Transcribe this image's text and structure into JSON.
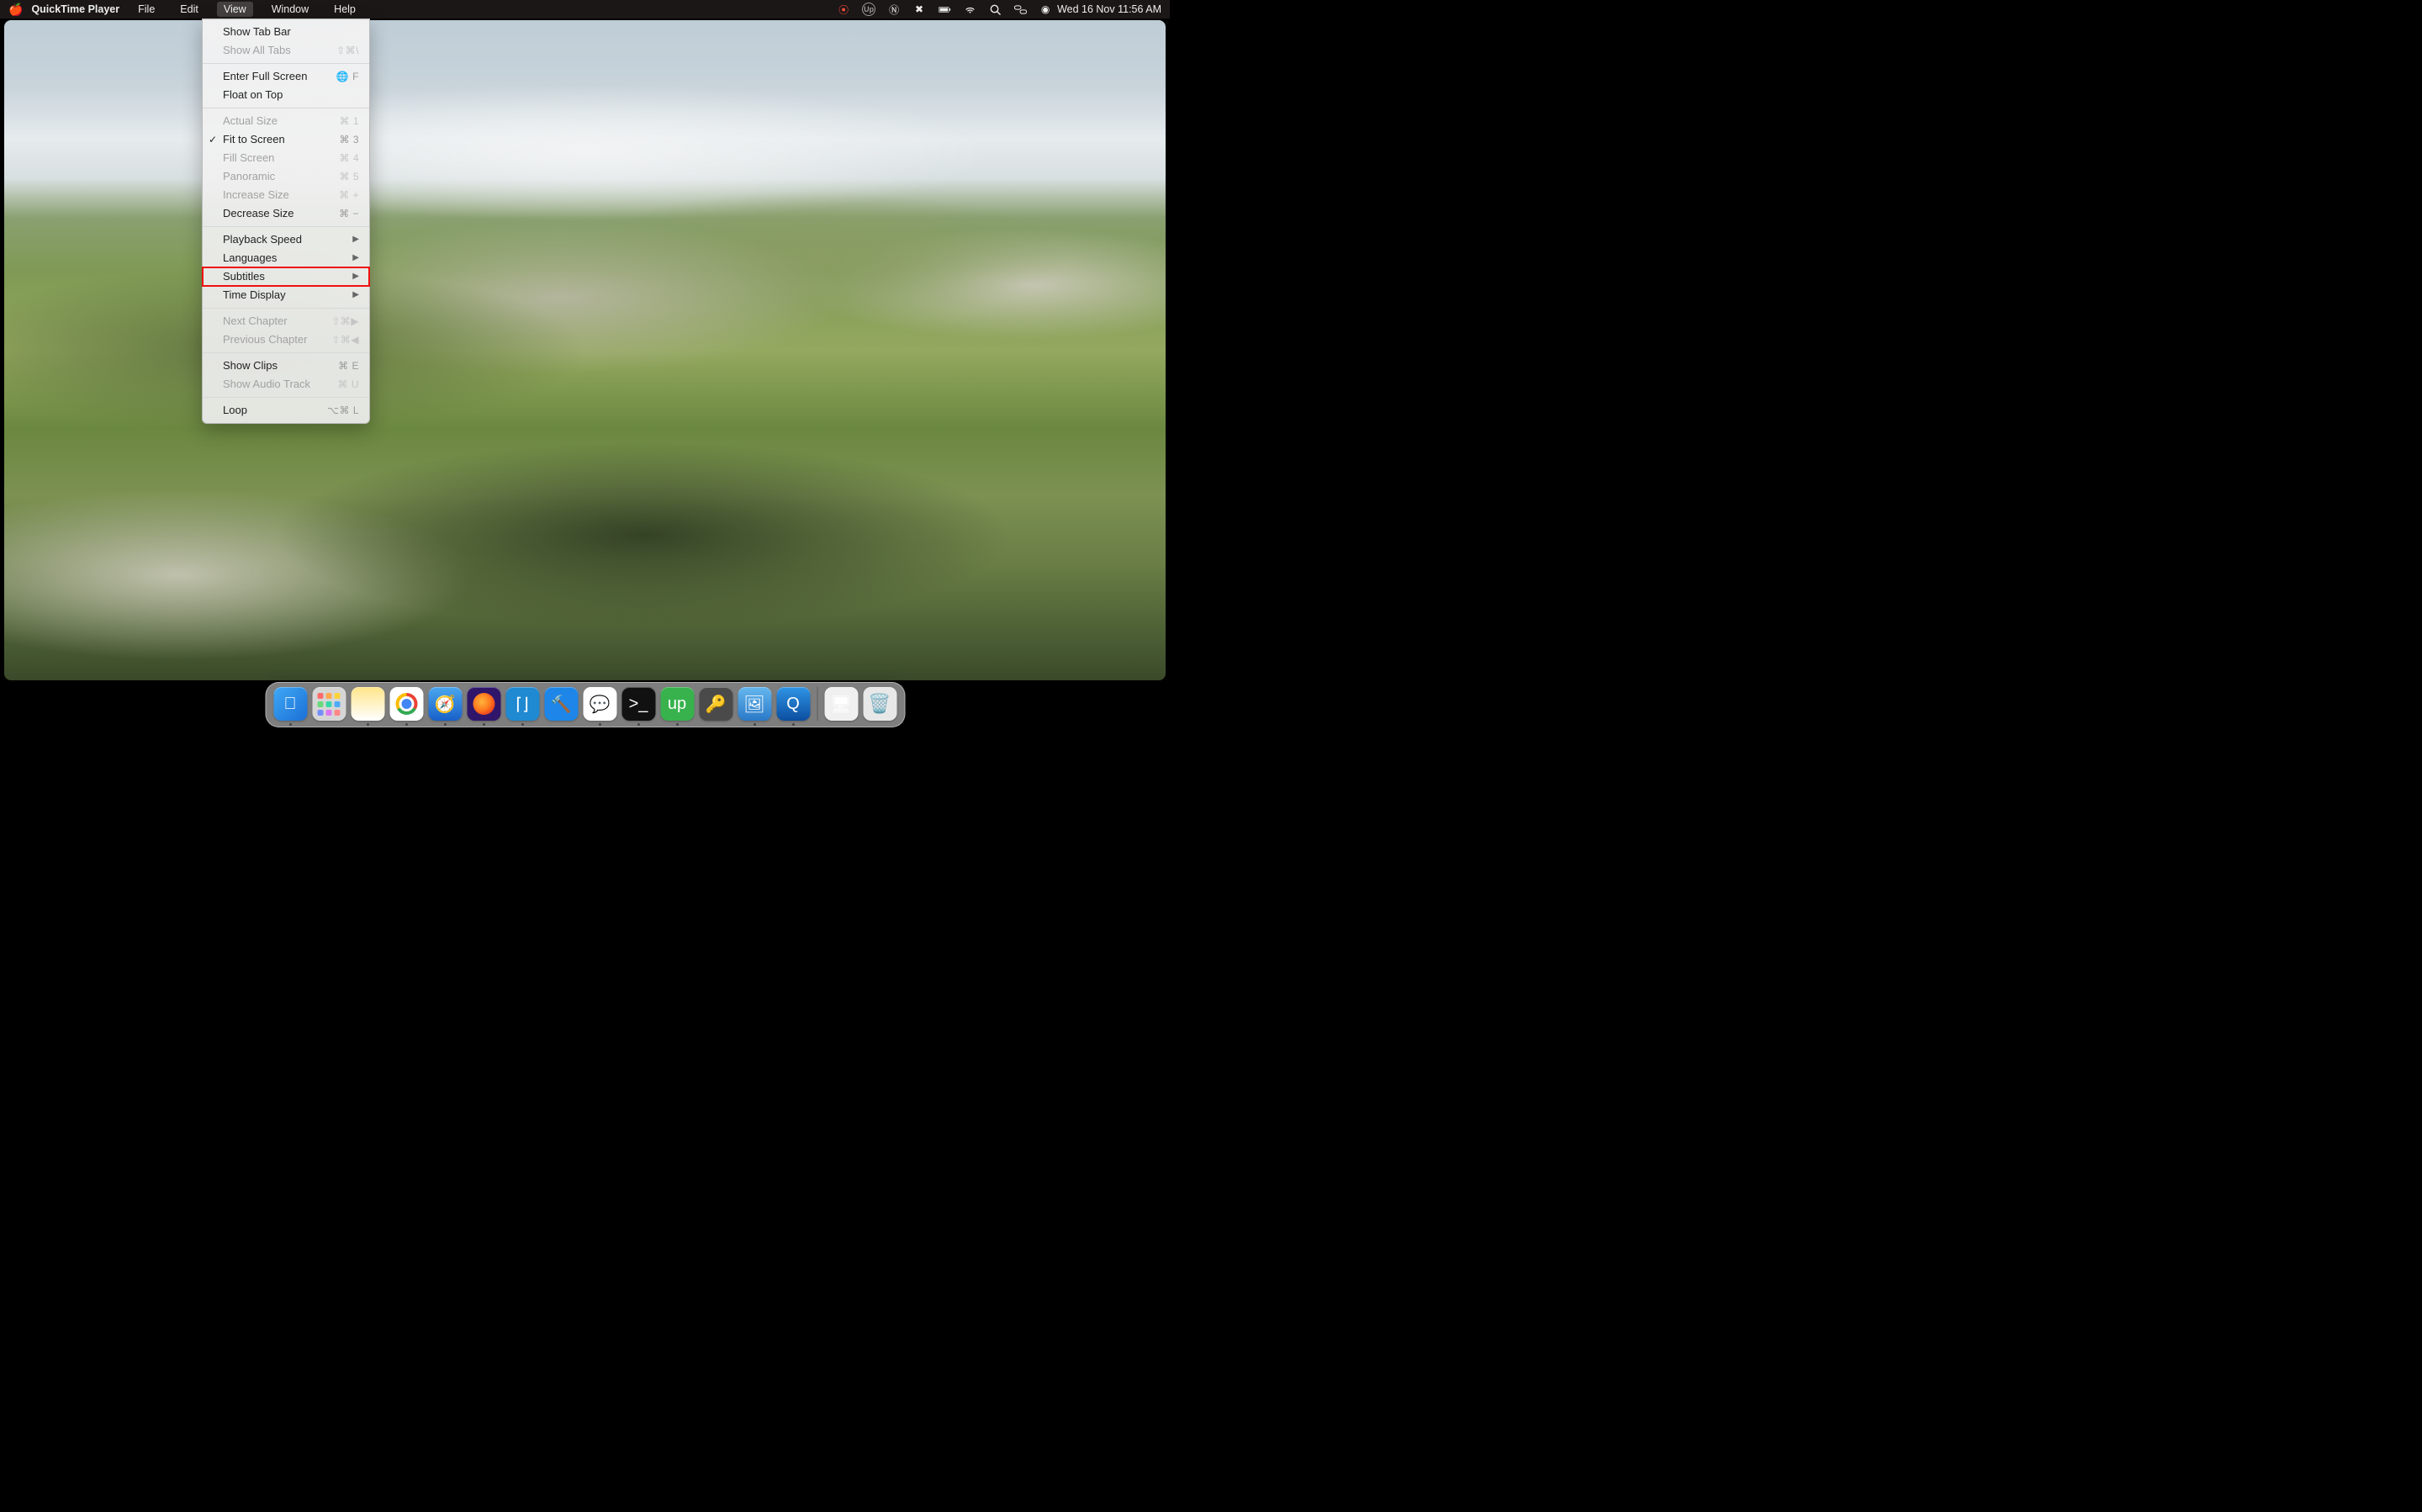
{
  "menubar": {
    "app_name": "QuickTime Player",
    "menus": [
      "File",
      "Edit",
      "View",
      "Window",
      "Help"
    ],
    "active_menu_index": 2,
    "datetime": "Wed 16 Nov  11:56 AM"
  },
  "view_menu": {
    "groups": [
      [
        {
          "label": "Show Tab Bar",
          "shortcut": "",
          "disabled": false
        },
        {
          "label": "Show All Tabs",
          "shortcut": "⇧⌘\\",
          "disabled": true
        }
      ],
      [
        {
          "label": "Enter Full Screen",
          "shortcut": "🌐 F",
          "disabled": false
        },
        {
          "label": "Float on Top",
          "shortcut": "",
          "disabled": false
        }
      ],
      [
        {
          "label": "Actual Size",
          "shortcut": "⌘ 1",
          "disabled": true
        },
        {
          "label": "Fit to Screen",
          "shortcut": "⌘ 3",
          "disabled": false,
          "checked": true
        },
        {
          "label": "Fill Screen",
          "shortcut": "⌘ 4",
          "disabled": true
        },
        {
          "label": "Panoramic",
          "shortcut": "⌘ 5",
          "disabled": true
        },
        {
          "label": "Increase Size",
          "shortcut": "⌘ +",
          "disabled": true
        },
        {
          "label": "Decrease Size",
          "shortcut": "⌘ −",
          "disabled": false
        }
      ],
      [
        {
          "label": "Playback Speed",
          "submenu": true,
          "disabled": false
        },
        {
          "label": "Languages",
          "submenu": true,
          "disabled": false
        },
        {
          "label": "Subtitles",
          "submenu": true,
          "disabled": false,
          "highlight": true
        },
        {
          "label": "Time Display",
          "submenu": true,
          "disabled": false
        }
      ],
      [
        {
          "label": "Next Chapter",
          "shortcut": "⇧⌘▶",
          "disabled": true
        },
        {
          "label": "Previous Chapter",
          "shortcut": "⇧⌘◀",
          "disabled": true
        }
      ],
      [
        {
          "label": "Show Clips",
          "shortcut": "⌘ E",
          "disabled": false
        },
        {
          "label": "Show Audio Track",
          "shortcut": "⌘ U",
          "disabled": true
        }
      ],
      [
        {
          "label": "Loop",
          "shortcut": "⌥⌘ L",
          "disabled": false
        }
      ]
    ]
  },
  "status_icons": [
    {
      "name": "screen-record-icon",
      "glyph": "⦿",
      "color": "#ff4d3d"
    },
    {
      "name": "upwork-status-icon",
      "glyph": "Up",
      "color": "#9a9a9a"
    },
    {
      "name": "notion-status-icon",
      "glyph": "Ⓝ"
    },
    {
      "name": "grammarly-status-icon",
      "glyph": "✖"
    },
    {
      "name": "battery-icon",
      "glyph": "battery"
    },
    {
      "name": "wifi-icon",
      "glyph": "wifi"
    },
    {
      "name": "spotlight-icon",
      "glyph": "search"
    },
    {
      "name": "control-center-icon",
      "glyph": "cc"
    },
    {
      "name": "siri-icon",
      "glyph": "◉"
    }
  ],
  "dock": [
    {
      "name": "finder",
      "running": true,
      "bg": "bg-finder",
      "glyph": "􀎞"
    },
    {
      "name": "launchpad",
      "running": false,
      "bg": "bg-launchpad"
    },
    {
      "name": "notes",
      "running": true,
      "bg": "bg-notes",
      "glyph": ""
    },
    {
      "name": "chrome",
      "running": true,
      "bg": "bg-chrome"
    },
    {
      "name": "safari",
      "running": true,
      "bg": "bg-safari",
      "glyph": "🧭"
    },
    {
      "name": "firefox",
      "running": true,
      "bg": "bg-firefox"
    },
    {
      "name": "vscode",
      "running": true,
      "bg": "bg-vscode",
      "glyph": "⌈⌋"
    },
    {
      "name": "xcode",
      "running": false,
      "bg": "bg-xcode",
      "glyph": "🔨"
    },
    {
      "name": "messages",
      "running": true,
      "bg": "bg-imsg",
      "glyph": "💬"
    },
    {
      "name": "terminal",
      "running": true,
      "bg": "bg-term",
      "glyph": ">_"
    },
    {
      "name": "upwork",
      "running": true,
      "bg": "bg-up",
      "glyph": "up"
    },
    {
      "name": "keychain",
      "running": false,
      "bg": "bg-keychain",
      "glyph": "🔑"
    },
    {
      "name": "preview",
      "running": true,
      "bg": "bg-preview",
      "glyph": "🖼"
    },
    {
      "name": "quicktime",
      "running": true,
      "bg": "bg-qt",
      "glyph": "Q"
    },
    {
      "name": "divider"
    },
    {
      "name": "desktop-folder",
      "running": false,
      "bg": "bg-folder",
      "glyph": "🖥"
    },
    {
      "name": "trash",
      "running": false,
      "bg": "bg-trash",
      "glyph": "🗑"
    }
  ]
}
